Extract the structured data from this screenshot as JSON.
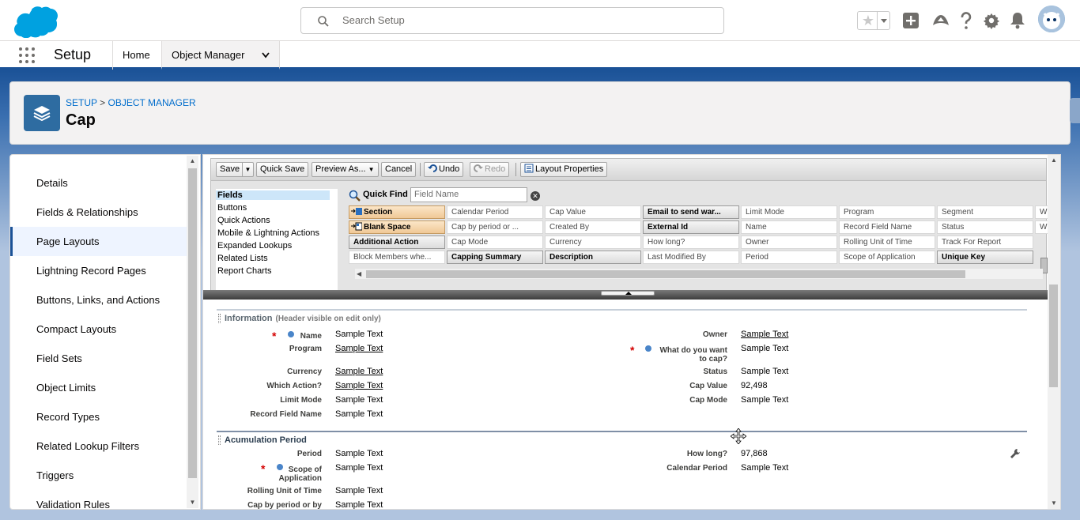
{
  "header": {
    "search_placeholder": "Search Setup",
    "icons": [
      "salesforce-logo",
      "favorite-star-icon",
      "add-icon",
      "trailhead-icon",
      "help-icon",
      "settings-gear-icon",
      "notification-bell-icon",
      "user-avatar"
    ]
  },
  "nav": {
    "app_name": "Setup",
    "tabs": [
      {
        "label": "Home"
      },
      {
        "label": "Object Manager"
      }
    ]
  },
  "page": {
    "breadcrumb": {
      "setup": "SETUP",
      "sep": ">",
      "object_manager": "OBJECT MANAGER"
    },
    "title": "Cap"
  },
  "sidebar": {
    "items": [
      {
        "label": "Details",
        "active": false
      },
      {
        "label": "Fields & Relationships",
        "active": false
      },
      {
        "label": "Page Layouts",
        "active": true
      },
      {
        "label": "Lightning Record Pages",
        "active": false
      },
      {
        "label": "Buttons, Links, and Actions",
        "active": false
      },
      {
        "label": "Compact Layouts",
        "active": false
      },
      {
        "label": "Field Sets",
        "active": false
      },
      {
        "label": "Object Limits",
        "active": false
      },
      {
        "label": "Record Types",
        "active": false
      },
      {
        "label": "Related Lookup Filters",
        "active": false
      },
      {
        "label": "Triggers",
        "active": false
      },
      {
        "label": "Validation Rules",
        "active": false
      }
    ]
  },
  "toolbar": {
    "save": "Save",
    "quick_save": "Quick Save",
    "preview_as": "Preview As...",
    "cancel": "Cancel",
    "undo": "Undo",
    "redo": "Redo",
    "layout_properties": "Layout Properties"
  },
  "palette": {
    "categories": [
      {
        "label": "Fields",
        "selected": true
      },
      {
        "label": "Buttons",
        "selected": false
      },
      {
        "label": "Quick Actions",
        "selected": false
      },
      {
        "label": "Mobile & Lightning Actions",
        "selected": false
      },
      {
        "label": "Expanded Lookups",
        "selected": false
      },
      {
        "label": "Related Lists",
        "selected": false
      },
      {
        "label": "Report Charts",
        "selected": false
      }
    ],
    "quick_find_label": "Quick Find",
    "quick_find_placeholder": "Field Name",
    "fields": [
      [
        {
          "label": "Section",
          "kind": "special"
        },
        {
          "label": "Calendar Period",
          "kind": "free"
        },
        {
          "label": "Cap Value",
          "kind": "free"
        },
        {
          "label": "Email to send war...",
          "kind": "used"
        },
        {
          "label": "Limit Mode",
          "kind": "free"
        },
        {
          "label": "Program",
          "kind": "free"
        },
        {
          "label": "Segment",
          "kind": "free"
        },
        {
          "label": "W",
          "kind": "free"
        }
      ],
      [
        {
          "label": "Blank Space",
          "kind": "special"
        },
        {
          "label": "Cap by period or ...",
          "kind": "free"
        },
        {
          "label": "Created By",
          "kind": "free"
        },
        {
          "label": "External Id",
          "kind": "used"
        },
        {
          "label": "Name",
          "kind": "free"
        },
        {
          "label": "Record Field Name",
          "kind": "free"
        },
        {
          "label": "Status",
          "kind": "free"
        },
        {
          "label": "W",
          "kind": "free"
        }
      ],
      [
        {
          "label": "Additional Action",
          "kind": "used"
        },
        {
          "label": "Cap Mode",
          "kind": "free"
        },
        {
          "label": "Currency",
          "kind": "free"
        },
        {
          "label": "How long?",
          "kind": "free"
        },
        {
          "label": "Owner",
          "kind": "free"
        },
        {
          "label": "Rolling Unit of Time",
          "kind": "free"
        },
        {
          "label": "Track For Report",
          "kind": "free"
        }
      ],
      [
        {
          "label": "Block Members whe...",
          "kind": "free"
        },
        {
          "label": "Capping Summary",
          "kind": "used"
        },
        {
          "label": "Description",
          "kind": "used"
        },
        {
          "label": "Last Modified By",
          "kind": "free"
        },
        {
          "label": "Period",
          "kind": "free"
        },
        {
          "label": "Scope of Application",
          "kind": "free"
        },
        {
          "label": "Unique Key",
          "kind": "used"
        }
      ]
    ]
  },
  "layout": {
    "info_section": {
      "title": "Information",
      "subtitle": "(Header visible on edit only)",
      "left": [
        {
          "label": "Name",
          "value": "Sample Text",
          "underline": false,
          "required": true
        },
        {
          "label": "Program",
          "value": "Sample Text",
          "underline": true,
          "required": false
        },
        {
          "label": "Currency",
          "value": "Sample Text",
          "underline": true,
          "required": false
        },
        {
          "label": "Which Action?",
          "value": "Sample Text",
          "underline": true,
          "required": false
        },
        {
          "label": "Limit Mode",
          "value": "Sample Text",
          "underline": false,
          "required": false
        },
        {
          "label": "Record Field Name",
          "value": "Sample Text",
          "underline": false,
          "required": false
        }
      ],
      "right": [
        {
          "label": "Owner",
          "value": "Sample Text",
          "underline": true,
          "required": false
        },
        {
          "label": "What do you want",
          "label2": "to cap?",
          "value": "Sample Text",
          "underline": false,
          "required": true
        },
        {
          "label": "Status",
          "value": "Sample Text",
          "underline": false,
          "required": false
        },
        {
          "label": "Cap Value",
          "value": "92,498",
          "underline": false,
          "required": false
        },
        {
          "label": "Cap Mode",
          "value": "Sample Text",
          "underline": false,
          "required": false
        }
      ]
    },
    "acc_section": {
      "title": "Acumulation Period",
      "left": [
        {
          "label": "Period",
          "value": "Sample Text",
          "required": false
        },
        {
          "label": "Scope of",
          "label2": "Application",
          "value": "Sample Text",
          "required": true
        },
        {
          "label": "Rolling Unit of Time",
          "value": "Sample Text",
          "required": false
        },
        {
          "label": "Cap by period or by",
          "value": "Sample Text",
          "required": false
        }
      ],
      "right": [
        {
          "label": "How long?",
          "value": "97,868",
          "required": false
        },
        {
          "label": "Calendar Period",
          "value": "Sample Text",
          "required": false
        }
      ]
    }
  },
  "colors": {
    "brand_blue": "#1b5297",
    "link_blue": "#006dcc",
    "required_red": "#d40000",
    "object_icon": "#2e6ca1"
  }
}
